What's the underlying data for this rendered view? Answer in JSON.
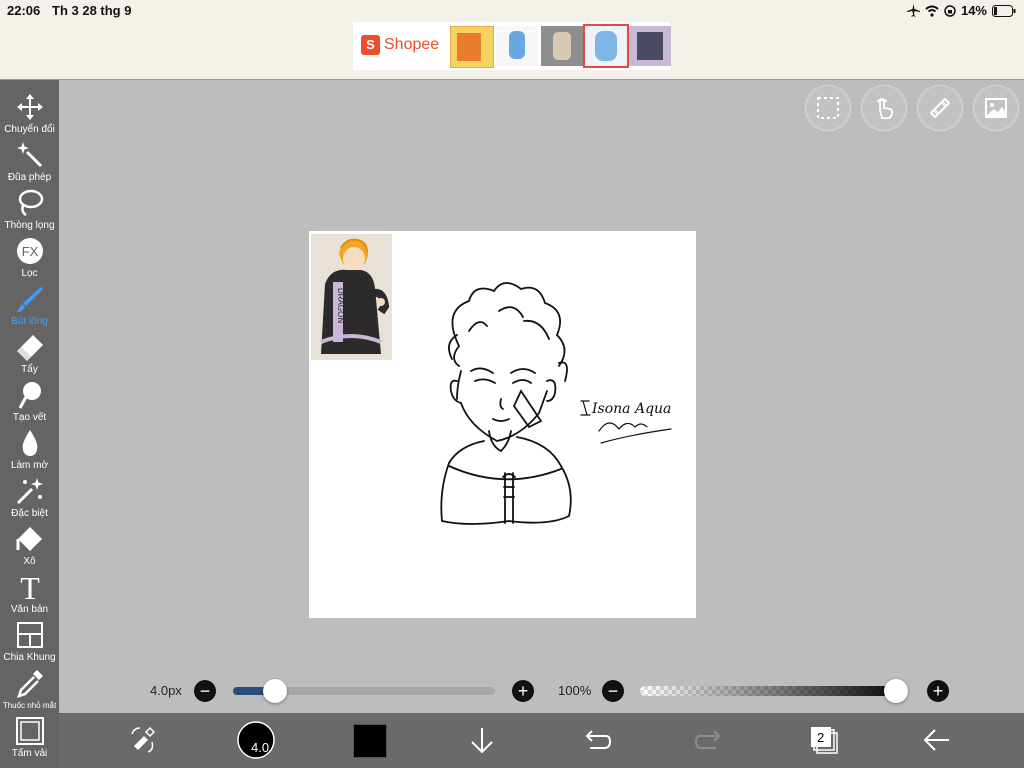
{
  "status": {
    "time": "22:06",
    "date": "Th 3 28 thg 9",
    "battery": "14%"
  },
  "ad": {
    "brand": "Shopee",
    "bag_letter": "S",
    "thumbs": 5
  },
  "tools": [
    {
      "label": "Chuyển đổi",
      "icon": "move-icon"
    },
    {
      "label": "Đũa phép",
      "icon": "magic-wand-icon"
    },
    {
      "label": "Thòng lọng",
      "icon": "lasso-icon"
    },
    {
      "label": "Lọc",
      "icon": "fx-filter-icon"
    },
    {
      "label": "Bút lông",
      "icon": "brush-icon",
      "active": true
    },
    {
      "label": "Tẩy",
      "icon": "eraser-icon"
    },
    {
      "label": "Tạo vết",
      "icon": "smudge-icon"
    },
    {
      "label": "Làm mờ",
      "icon": "blur-drop-icon"
    },
    {
      "label": "Đặc biệt",
      "icon": "special-sparkle-icon"
    },
    {
      "label": "Xô",
      "icon": "bucket-icon"
    },
    {
      "label": "Văn bản",
      "icon": "text-icon"
    },
    {
      "label": "Chia Khung",
      "icon": "frame-divider-icon"
    },
    {
      "label": "Thuốc nhỏ mắt",
      "icon": "eyedropper-icon"
    },
    {
      "label": "Tấm vải",
      "icon": "canvas-icon"
    }
  ],
  "canvas": {
    "signature_line1": "Isona Aqua",
    "signature_line2": "aqua",
    "hood_text": "DRAGON"
  },
  "brush": {
    "size_label": "4.0px",
    "size_value": "4.0",
    "size_fraction": 0.16
  },
  "opacity": {
    "label": "100%",
    "fraction": 1.0
  },
  "layers": {
    "count": "2"
  },
  "colors": {
    "sidebar": "#646464",
    "bottombar": "#6a6a6a",
    "accent": "#3aa0ff",
    "current_color": "#000000",
    "shopee": "#ee4d2d"
  }
}
